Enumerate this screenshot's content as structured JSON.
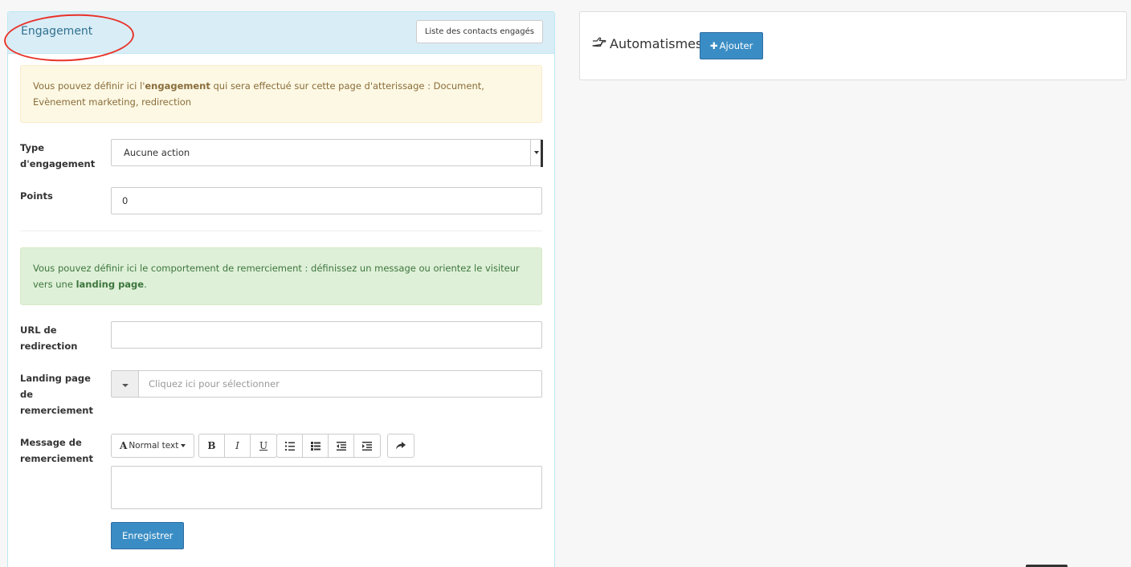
{
  "engagement": {
    "title": "Engagement",
    "list_button": "Liste des contacts engagés",
    "warning": {
      "text_before": "Vous pouvez définir ici l'",
      "bold": "engagement",
      "text_after": " qui sera effectué sur cette page d'atterissage : Document, Evènement marketing, redirection"
    },
    "type_label": "Type d'engagement",
    "type_value": "Aucune action",
    "points_label": "Points",
    "points_value": "0",
    "success": {
      "text_before": "Vous pouvez définir ici le comportement de remerciement : définissez un message ou orientez le visiteur vers une ",
      "bold": "landing page",
      "text_after": "."
    },
    "url_label": "URL de redirection",
    "url_value": "",
    "landing_label": "Landing page de remerciement",
    "landing_placeholder": "Cliquez ici pour sélectionner",
    "message_label": "Message de remerciement",
    "toolbar": {
      "font_glyph": "A",
      "font_label": "Normal text",
      "bold": "B",
      "italic": "I",
      "underline": "U"
    },
    "save_button": "Enregistrer"
  },
  "automations": {
    "title": "Automatismes",
    "add_button": "Ajouter"
  },
  "colors": {
    "primary": "#3a8dc4",
    "heading_bg": "#d9edf7",
    "warning_bg": "#fcf8e3",
    "success_bg": "#dff0d8",
    "annotation": "#e8332a"
  }
}
